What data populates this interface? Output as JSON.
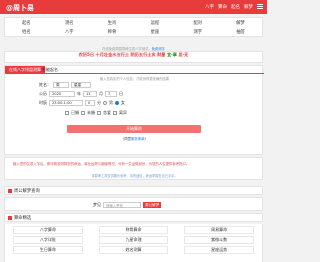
{
  "header": {
    "logo": "@周卜易",
    "nav": [
      "八字",
      "算命",
      "起名",
      "解梦"
    ]
  },
  "nav_grid": [
    "起名",
    "测名",
    "生肖",
    "运程",
    "配对",
    "解梦",
    "姓名",
    "八字",
    "称骨",
    "星座",
    "测字",
    "抽签"
  ],
  "notice": {
    "text": "在线免费周易算命生辰八字测试，",
    "link": "免费测字"
  },
  "date": {
    "text": "农历5日 十月壮金水五行土 阴历五行土亥 财星",
    "yi": "宜·事",
    "ji": "忌·无"
  },
  "form": {
    "tab_active": "在线八字排盘测算",
    "tab_second": "智能起名",
    "note": "输入您真实的个人信息，才能测得更准确的结果",
    "name_label": "姓名：",
    "surname": "周",
    "given_name": "星",
    "given_placeholder": "星星",
    "birth_label": "公历",
    "year": "2020",
    "year_unit": "年",
    "month": "11",
    "month_unit": "月",
    "day": "7",
    "day_unit": "日",
    "time_label": "时辰",
    "time": "23:00-1:00",
    "minute": "0",
    "minute_unit": "分",
    "gender_male": "男",
    "gender_female": "女",
    "options": [
      "已婚",
      "未婚",
      "恋爱",
      "离异"
    ],
    "submit": "开始算命",
    "rule_prefix": "（同意",
    "rule_link": "服务条款",
    "rule_suffix": "）"
  },
  "description": {
    "main": "输入您的生辰八字后，即可精准测算您的命运、事业运势与姻缘情况，分析一生运势起伏，为您的人生提供参考指引。",
    "sub": "本算命工具仅供娱乐参考，请勿迷信，命运掌握在自己手中。"
  },
  "dream": {
    "title": "周公解梦查询",
    "label": "梦见",
    "placeholder": "请输入梦到",
    "button": "周公解梦"
  },
  "categories": {
    "title": "算命精选",
    "items": [
      "八字算命",
      "称骨算命",
      "周易算命",
      "八字详批",
      "九星命理",
      "紫微斗数",
      "生日算命",
      "姓名测算",
      "星座运势"
    ]
  }
}
